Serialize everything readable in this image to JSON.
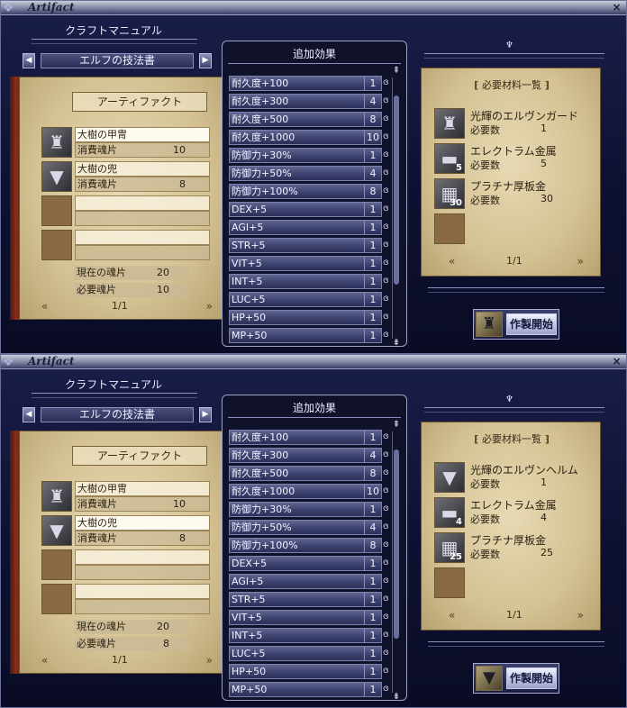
{
  "windows": [
    {
      "title": "Artifact",
      "close_label": "×",
      "manual_title": "クラフトマニュアル",
      "book_name": "エルフの技法書",
      "section_title": "アーティファクト",
      "recipes": [
        {
          "name": "大樹の甲冑",
          "cost_label": "消費魂片",
          "cost": "10",
          "selected": true,
          "icon": "armor-icon"
        },
        {
          "name": "大樹の兜",
          "cost_label": "消費魂片",
          "cost": "8",
          "selected": false,
          "icon": "helm-icon"
        },
        {
          "name": "",
          "cost_label": "",
          "cost": "",
          "selected": false,
          "icon": ""
        },
        {
          "name": "",
          "cost_label": "",
          "cost": "",
          "selected": false,
          "icon": ""
        }
      ],
      "current_souls_label": "現在の魂片",
      "current_souls": "20",
      "required_souls_label": "必要魂片",
      "required_souls": "10",
      "left_page": "1/1",
      "effects_header": "追加効果",
      "effects": [
        {
          "label": "耐久度+100",
          "value": "1"
        },
        {
          "label": "耐久度+300",
          "value": "4"
        },
        {
          "label": "耐久度+500",
          "value": "8"
        },
        {
          "label": "耐久度+1000",
          "value": "10"
        },
        {
          "label": "防御力+30%",
          "value": "1"
        },
        {
          "label": "防御力+50%",
          "value": "4"
        },
        {
          "label": "防御力+100%",
          "value": "8"
        },
        {
          "label": "DEX+5",
          "value": "1"
        },
        {
          "label": "AGI+5",
          "value": "1"
        },
        {
          "label": "STR+5",
          "value": "1"
        },
        {
          "label": "VIT+5",
          "value": "1"
        },
        {
          "label": "INT+5",
          "value": "1"
        },
        {
          "label": "LUC+5",
          "value": "1"
        },
        {
          "label": "HP+50",
          "value": "1"
        },
        {
          "label": "MP+50",
          "value": "1"
        }
      ],
      "materials_title": "必要材料一覧",
      "materials": [
        {
          "name": "光輝のエルヴンガード",
          "qty_label": "必要数",
          "qty": "1",
          "count_badge": "",
          "icon": "armor-icon"
        },
        {
          "name": "エレクトラム金属",
          "qty_label": "必要数",
          "qty": "5",
          "count_badge": "5",
          "icon": "ingot-icon"
        },
        {
          "name": "プラチナ厚板金",
          "qty_label": "必要数",
          "qty": "30",
          "count_badge": "30",
          "icon": "plate-icon"
        }
      ],
      "right_page": "1/1",
      "craft_label": "作製開始",
      "craft_icon": "armor-icon"
    },
    {
      "title": "Artifact",
      "close_label": "×",
      "manual_title": "クラフトマニュアル",
      "book_name": "エルフの技法書",
      "section_title": "アーティファクト",
      "recipes": [
        {
          "name": "大樹の甲冑",
          "cost_label": "消費魂片",
          "cost": "10",
          "selected": false,
          "icon": "armor-icon"
        },
        {
          "name": "大樹の兜",
          "cost_label": "消費魂片",
          "cost": "8",
          "selected": true,
          "icon": "helm-icon"
        },
        {
          "name": "",
          "cost_label": "",
          "cost": "",
          "selected": false,
          "icon": ""
        },
        {
          "name": "",
          "cost_label": "",
          "cost": "",
          "selected": false,
          "icon": ""
        }
      ],
      "current_souls_label": "現在の魂片",
      "current_souls": "20",
      "required_souls_label": "必要魂片",
      "required_souls": "8",
      "left_page": "1/1",
      "effects_header": "追加効果",
      "effects": [
        {
          "label": "耐久度+100",
          "value": "1"
        },
        {
          "label": "耐久度+300",
          "value": "4"
        },
        {
          "label": "耐久度+500",
          "value": "8"
        },
        {
          "label": "耐久度+1000",
          "value": "10"
        },
        {
          "label": "防御力+30%",
          "value": "1"
        },
        {
          "label": "防御力+50%",
          "value": "4"
        },
        {
          "label": "防御力+100%",
          "value": "8"
        },
        {
          "label": "DEX+5",
          "value": "1"
        },
        {
          "label": "AGI+5",
          "value": "1"
        },
        {
          "label": "STR+5",
          "value": "1"
        },
        {
          "label": "VIT+5",
          "value": "1"
        },
        {
          "label": "INT+5",
          "value": "1"
        },
        {
          "label": "LUC+5",
          "value": "1"
        },
        {
          "label": "HP+50",
          "value": "1"
        },
        {
          "label": "MP+50",
          "value": "1"
        }
      ],
      "materials_title": "必要材料一覧",
      "materials": [
        {
          "name": "光輝のエルヴンヘルム",
          "qty_label": "必要数",
          "qty": "1",
          "count_badge": "",
          "icon": "helm-icon"
        },
        {
          "name": "エレクトラム金属",
          "qty_label": "必要数",
          "qty": "4",
          "count_badge": "4",
          "icon": "ingot-icon"
        },
        {
          "name": "プラチナ厚板金",
          "qty_label": "必要数",
          "qty": "25",
          "count_badge": "25",
          "icon": "plate-icon"
        }
      ],
      "right_page": "1/1",
      "craft_label": "作製開始",
      "craft_icon": "helm-icon"
    }
  ]
}
